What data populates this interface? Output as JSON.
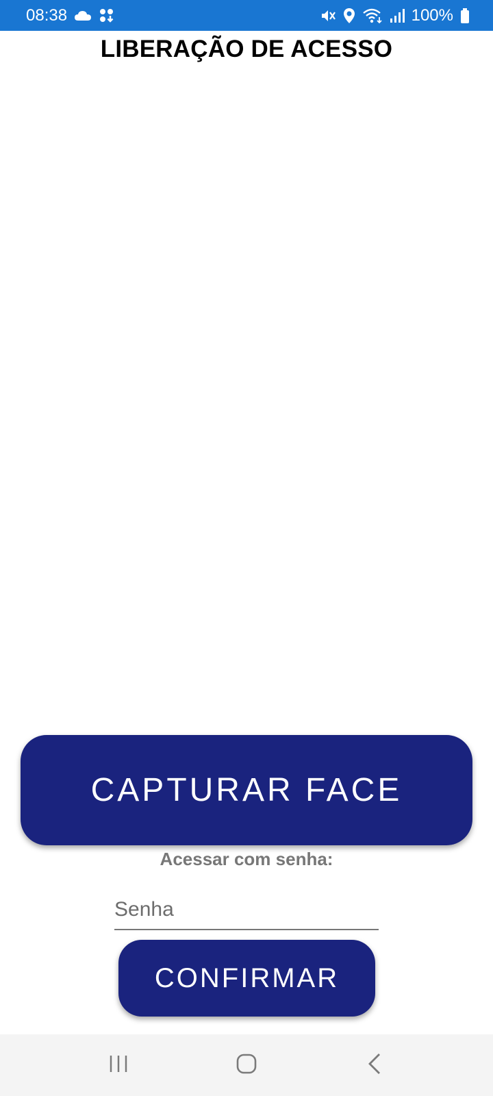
{
  "status_bar": {
    "time": "08:38",
    "battery": "100%",
    "icons": [
      "cloud-icon",
      "apps-download-icon",
      "mute-vibrate-icon",
      "location-icon",
      "wifi-icon",
      "signal-icon",
      "battery-icon"
    ]
  },
  "header": {
    "title": "LIBERAÇÃO DE ACESSO"
  },
  "main": {
    "capture_button_label": "CAPTURAR FACE",
    "password_prompt": "Acessar com senha:",
    "password_placeholder": "Senha",
    "confirm_button_label": "CONFIRMAR"
  },
  "nav_bar": {
    "icons": [
      "recent-apps-icon",
      "home-icon",
      "back-icon"
    ]
  },
  "colors": {
    "status_bar_bg": "#1976d2",
    "button_bg": "#1a237e",
    "prompt_text": "#777777"
  }
}
